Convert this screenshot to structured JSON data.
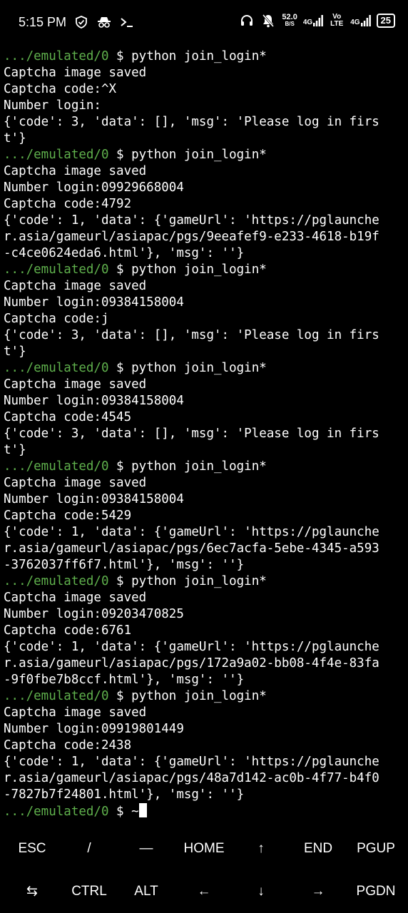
{
  "statusbar": {
    "time": "5:15 PM",
    "app_icons": [
      "shield-check-icon",
      "incognito-icon",
      "terminal-prompt-icon"
    ],
    "net_speed_value": "52.0",
    "net_speed_unit": "B/S",
    "sim1": "4G",
    "sim2": "4G",
    "volte": "Vo LTE",
    "battery": "25"
  },
  "terminal": {
    "path": ".../emulated/0",
    "command": "$ python join_login*",
    "final_command": "$ ~",
    "lines": [
      {
        "type": "prompt"
      },
      {
        "type": "out",
        "text": "Captcha image saved"
      },
      {
        "type": "out",
        "text": "Captcha code:^X"
      },
      {
        "type": "out",
        "text": "Number login:"
      },
      {
        "type": "out",
        "text": "{'code': 3, 'data': [], 'msg': 'Please log in firs"
      },
      {
        "type": "out",
        "text": "t'}"
      },
      {
        "type": "prompt"
      },
      {
        "type": "out",
        "text": "Captcha image saved"
      },
      {
        "type": "out",
        "text": "Number login:09929668004"
      },
      {
        "type": "out",
        "text": "Captcha code:4792"
      },
      {
        "type": "out",
        "text": "{'code': 1, 'data': {'gameUrl': 'https://pglaunche"
      },
      {
        "type": "out",
        "text": "r.asia/gameurl/asiapac/pgs/9eeafef9-e233-4618-b19f"
      },
      {
        "type": "out",
        "text": "-c4ce0624eda6.html'}, 'msg': ''}"
      },
      {
        "type": "prompt"
      },
      {
        "type": "out",
        "text": "Captcha image saved"
      },
      {
        "type": "out",
        "text": "Number login:09384158004"
      },
      {
        "type": "out",
        "text": "Captcha code:j"
      },
      {
        "type": "out",
        "text": "{'code': 3, 'data': [], 'msg': 'Please log in firs"
      },
      {
        "type": "out",
        "text": "t'}"
      },
      {
        "type": "prompt"
      },
      {
        "type": "out",
        "text": "Captcha image saved"
      },
      {
        "type": "out",
        "text": "Number login:09384158004"
      },
      {
        "type": "out",
        "text": "Captcha code:4545"
      },
      {
        "type": "out",
        "text": "{'code': 3, 'data': [], 'msg': 'Please log in firs"
      },
      {
        "type": "out",
        "text": "t'}"
      },
      {
        "type": "prompt"
      },
      {
        "type": "out",
        "text": "Captcha image saved"
      },
      {
        "type": "out",
        "text": "Number login:09384158004"
      },
      {
        "type": "out",
        "text": "Captcha code:5429"
      },
      {
        "type": "out",
        "text": "{'code': 1, 'data': {'gameUrl': 'https://pglaunche"
      },
      {
        "type": "out",
        "text": "r.asia/gameurl/asiapac/pgs/6ec7acfa-5ebe-4345-a593"
      },
      {
        "type": "out",
        "text": "-3762037ff6f7.html'}, 'msg': ''}"
      },
      {
        "type": "prompt"
      },
      {
        "type": "out",
        "text": "Captcha image saved"
      },
      {
        "type": "out",
        "text": "Number login:09203470825"
      },
      {
        "type": "out",
        "text": "Captcha code:6761"
      },
      {
        "type": "out",
        "text": "{'code': 1, 'data': {'gameUrl': 'https://pglaunche"
      },
      {
        "type": "out",
        "text": "r.asia/gameurl/asiapac/pgs/172a9a02-bb08-4f4e-83fa"
      },
      {
        "type": "out",
        "text": "-9f0fbe7b8ccf.html'}, 'msg': ''}"
      },
      {
        "type": "prompt"
      },
      {
        "type": "out",
        "text": "Captcha image saved"
      },
      {
        "type": "out",
        "text": "Number login:09919801449"
      },
      {
        "type": "out",
        "text": "Captcha code:2438"
      },
      {
        "type": "out",
        "text": "{'code': 1, 'data': {'gameUrl': 'https://pglaunche"
      },
      {
        "type": "out",
        "text": "r.asia/gameurl/asiapac/pgs/48a7d142-ac0b-4f77-b4f0"
      },
      {
        "type": "out",
        "text": "-7827b7f24801.html'}, 'msg': ''}"
      },
      {
        "type": "final"
      }
    ]
  },
  "extra_keys": {
    "row1": [
      "ESC",
      "/",
      "—",
      "HOME",
      "↑",
      "END",
      "PGUP"
    ],
    "row2": [
      "⇆",
      "CTRL",
      "ALT",
      "←",
      "↓",
      "→",
      "PGDN"
    ]
  },
  "colors": {
    "background": "#000000",
    "text": "#ffffff",
    "prompt_path": "#5fb04c"
  }
}
